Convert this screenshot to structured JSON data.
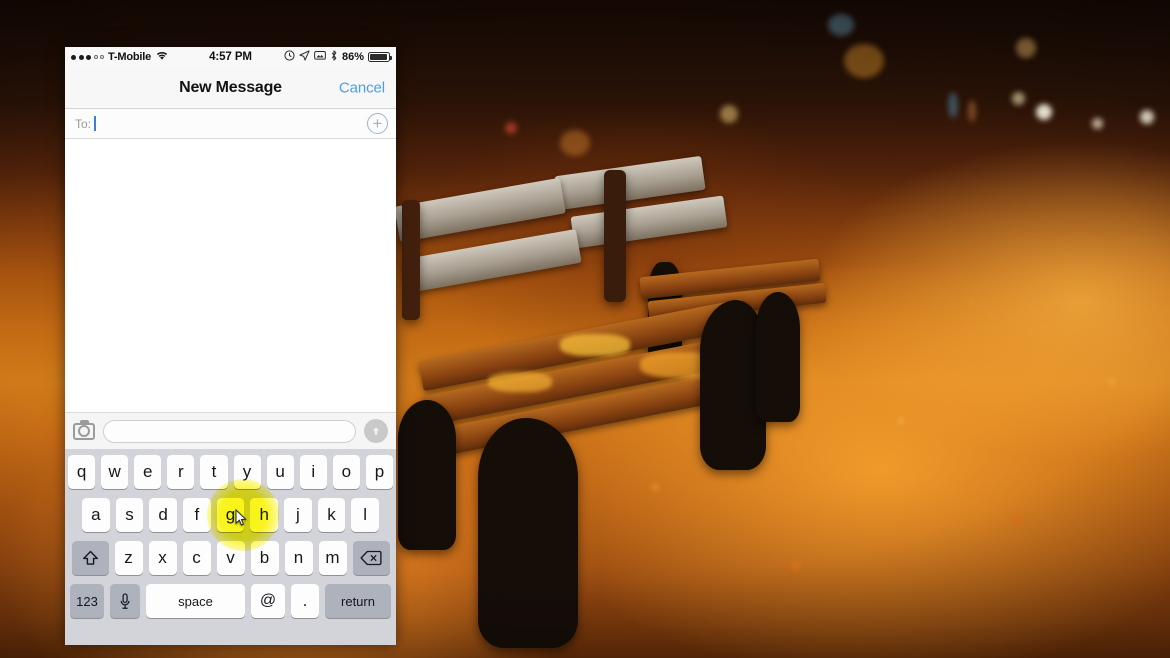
{
  "background": {
    "description": "autumn park path with park benches covered in orange fallen leaves",
    "accent_orange": "#c26a14",
    "dark_canopy": "#140803"
  },
  "phone": {
    "status_bar": {
      "signal_dots_filled": 3,
      "signal_dots_empty": 2,
      "carrier": "T-Mobile",
      "wifi_icon": "wifi-icon",
      "time": "4:57 PM",
      "icons": [
        "alarm-clock-icon",
        "location-arrow-icon",
        "screen-mirroring-icon",
        "bluetooth-icon"
      ],
      "battery_percent": "86%",
      "battery_icon": "battery-icon"
    },
    "nav_bar": {
      "title": "New Message",
      "cancel_label": "Cancel",
      "cancel_color": "#4aa0e8"
    },
    "to_field": {
      "label": "To:",
      "value": "",
      "add_contact_icon": "plus-circle-icon"
    },
    "input_bar": {
      "camera_icon": "camera-icon",
      "message_placeholder": "",
      "message_value": "",
      "send_icon": "send-arrow-up-icon",
      "send_enabled": false
    },
    "keyboard": {
      "row1": [
        "q",
        "w",
        "e",
        "r",
        "t",
        "y",
        "u",
        "i",
        "o",
        "p"
      ],
      "row2": [
        "a",
        "s",
        "d",
        "f",
        "g",
        "h",
        "j",
        "k",
        "l"
      ],
      "row3_shift_icon": "shift-arrow-up-icon",
      "row3": [
        "z",
        "x",
        "c",
        "v",
        "b",
        "n",
        "m"
      ],
      "row3_delete_icon": "backspace-delete-icon",
      "numeric_label": "123",
      "dictation_icon": "microphone-icon",
      "space_label": "space",
      "at_label": "@",
      "period_label": ".",
      "return_label": "return",
      "highlight_color": "#faf500",
      "highlighted_keys": [
        "g",
        "h"
      ]
    }
  }
}
